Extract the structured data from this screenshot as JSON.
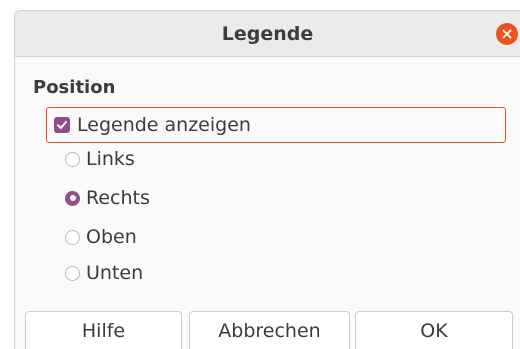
{
  "window": {
    "title": "Legende",
    "close_icon": "close-icon",
    "accent_color": "#e95420"
  },
  "position": {
    "section_label": "Position",
    "show_legend": {
      "label": "Legende anzeigen",
      "checked": true
    },
    "options": [
      {
        "label": "Links",
        "selected": false
      },
      {
        "label": "Rechts",
        "selected": true
      },
      {
        "label": "Oben",
        "selected": false
      },
      {
        "label": "Unten",
        "selected": false
      }
    ],
    "checked_color": "#924d8b"
  },
  "buttons": {
    "help": "Hilfe",
    "cancel": "Abbrechen",
    "ok": "OK"
  }
}
